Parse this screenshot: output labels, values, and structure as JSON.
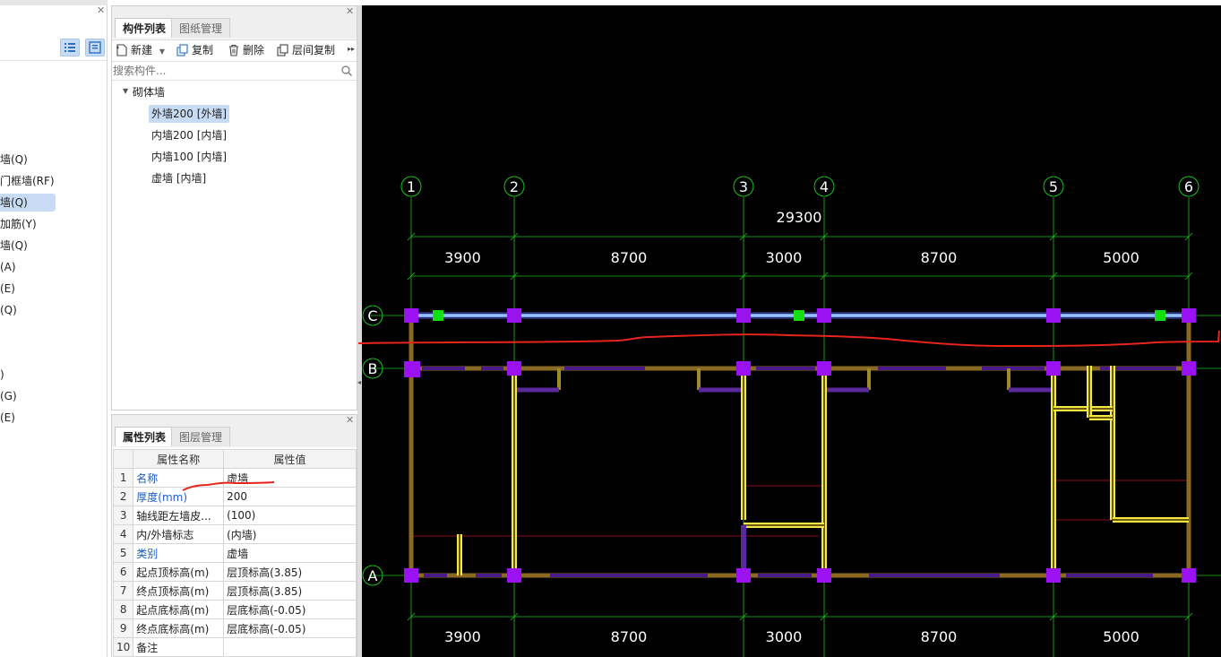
{
  "left_panel": {
    "items": [
      {
        "label": "墙(Q)",
        "selected": false
      },
      {
        "label": "门框墙(RF)",
        "selected": false
      },
      {
        "label": "墙(Q)",
        "selected": true
      },
      {
        "label": "加筋(Y)",
        "selected": false
      },
      {
        "label": "墙(Q)",
        "selected": false
      },
      {
        "label": "(A)",
        "selected": false
      },
      {
        "label": "(E)",
        "selected": false
      },
      {
        "label": "(Q)",
        "selected": false
      },
      {
        "label": ")",
        "selected": false
      },
      {
        "label": "(G)",
        "selected": false
      },
      {
        "label": "(E)",
        "selected": false
      }
    ]
  },
  "component_panel": {
    "tabs": [
      "构件列表",
      "图纸管理"
    ],
    "toolbar": {
      "new": "新建",
      "copy": "复制",
      "delete": "删除",
      "floor_copy": "层间复制"
    },
    "search_placeholder": "搜索构件...",
    "tree_root": "砌体墙",
    "items": [
      {
        "label": "外墙200 [外墙]",
        "selected": true
      },
      {
        "label": "内墙200 [内墙]",
        "selected": false
      },
      {
        "label": "内墙100 [内墙]",
        "selected": false
      },
      {
        "label": "虚墙 [内墙]",
        "selected": false
      }
    ]
  },
  "property_panel": {
    "tabs": [
      "属性列表",
      "图层管理"
    ],
    "headers": [
      "属性名称",
      "属性值"
    ],
    "rows": [
      {
        "num": "1",
        "name": "名称",
        "value": "虚墙",
        "blue": true
      },
      {
        "num": "2",
        "name": "厚度(mm)",
        "value": "200",
        "blue": true
      },
      {
        "num": "3",
        "name": "轴线距左墙皮...",
        "value": "(100)",
        "blue": false
      },
      {
        "num": "4",
        "name": "内/外墙标志",
        "value": "(内墙)",
        "blue": false
      },
      {
        "num": "5",
        "name": "类别",
        "value": "虚墙",
        "blue": true
      },
      {
        "num": "6",
        "name": "起点顶标高(m)",
        "value": "层顶标高(3.85)",
        "blue": false
      },
      {
        "num": "7",
        "name": "终点顶标高(m)",
        "value": "层顶标高(3.85)",
        "blue": false
      },
      {
        "num": "8",
        "name": "起点底标高(m)",
        "value": "层底标高(-0.05)",
        "blue": false
      },
      {
        "num": "9",
        "name": "终点底标高(m)",
        "value": "层底标高(-0.05)",
        "blue": false
      },
      {
        "num": "10",
        "name": "备注",
        "value": "",
        "blue": false
      }
    ]
  },
  "drawing": {
    "axes_x": [
      {
        "label": "1"
      },
      {
        "label": "2"
      },
      {
        "label": "3"
      },
      {
        "label": "4"
      },
      {
        "label": "5"
      },
      {
        "label": "6"
      }
    ],
    "axes_y": [
      {
        "label": "C"
      },
      {
        "label": "B"
      },
      {
        "label": "A"
      }
    ],
    "total_dim": "29300",
    "dims": [
      "3900",
      "8700",
      "3000",
      "8700",
      "5000"
    ],
    "colors": {
      "background": "#000000",
      "axis": "#19c219",
      "wall_brown": "#8a6a22",
      "wall_yellow": "#f4e842",
      "column": "#9a12f2",
      "selected_wall": "#6fa4f0",
      "markup": "#e8241c"
    }
  }
}
